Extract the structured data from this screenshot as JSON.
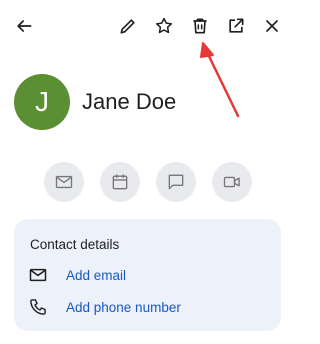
{
  "toolbar": {
    "icons": [
      "back-arrow-icon",
      "edit-pencil-icon",
      "star-icon",
      "trash-icon",
      "open-in-new-icon",
      "close-icon"
    ],
    "annotation_color": "#e53935"
  },
  "contact": {
    "initial": "J",
    "name": "Jane Doe",
    "avatar_color": "#5b8f34"
  },
  "quick_actions": {
    "icons": [
      "mail-icon",
      "calendar-icon",
      "chat-icon",
      "video-icon"
    ],
    "background_color": "#e8eaed"
  },
  "details": {
    "title": "Contact details",
    "add_email_label": "Add email",
    "add_phone_label": "Add phone number",
    "link_color": "#1a57c6",
    "card_color": "#edf1f9"
  }
}
